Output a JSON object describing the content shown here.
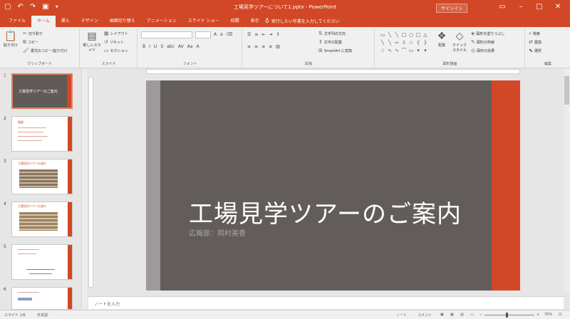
{
  "window": {
    "title": "工場見学ツアーについて1.pptx - PowerPoint",
    "signin": "サインイン"
  },
  "qat": {
    "save": "▢",
    "undo": "↶",
    "redo": "↷",
    "present": "▣",
    "more": "▾"
  },
  "tabs": [
    "ファイル",
    "ホーム",
    "挿入",
    "デザイン",
    "画面切り替え",
    "アニメーション",
    "スライド ショー",
    "校閲",
    "表示"
  ],
  "tellme": "実行したい作業を入力してください",
  "ribbon": {
    "clipboard": {
      "paste": "貼り付け",
      "cut": "切り取り",
      "copy": "コピー",
      "format_painter": "書式のコピー/貼り付け",
      "label": "クリップボード"
    },
    "slides": {
      "new_slide": "新しいスライド",
      "layout": "レイアウト",
      "reset": "リセット",
      "section": "セクション",
      "label": "スライド"
    },
    "font": {
      "label": "フォント",
      "bold": "B",
      "italic": "I",
      "underline": "U",
      "strike": "S",
      "shadow": "abc"
    },
    "paragraph": {
      "text_direction": "文字列の方向",
      "align_text": "文字の配置",
      "smartart": "SmartArt に変換",
      "label": "段落"
    },
    "drawing": {
      "arrange": "配置",
      "quick_styles": "クイック スタイル",
      "shape_fill": "図形の塗りつぶし",
      "shape_outline": "図形の枠線",
      "shape_effects": "図形の効果",
      "label": "図形描画"
    },
    "editing": {
      "find": "検索",
      "replace": "置換",
      "select": "選択",
      "label": "編集"
    }
  },
  "thumbnails": [
    {
      "num": "1",
      "title": "工場見学ツアーのご案内"
    },
    {
      "num": "2",
      "title": "概要"
    },
    {
      "num": "3",
      "title": "工場見学ツアーの流れ"
    },
    {
      "num": "4",
      "title": "工場見学ツアーの流れ"
    },
    {
      "num": "5",
      "title": ""
    },
    {
      "num": "6",
      "title": ""
    }
  ],
  "slide": {
    "title": "工場見学ツアーのご案内",
    "subtitle": "広報部：岡村美香"
  },
  "notes": {
    "placeholder": "ノートを入力"
  },
  "status": {
    "slide_count": "スライド 1/6",
    "language": "日本語",
    "notes": "ノート",
    "comments": "コメント",
    "zoom": "70%"
  },
  "colors": {
    "accent": "#d24726",
    "slide_bg": "#625d5b"
  }
}
